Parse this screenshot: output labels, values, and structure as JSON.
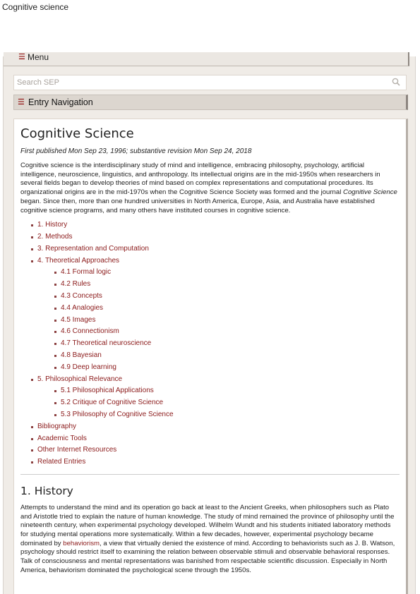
{
  "window": {
    "title": "Cognitive science"
  },
  "menu": {
    "label": "Menu"
  },
  "search": {
    "placeholder": "Search SEP"
  },
  "entry_nav": {
    "label": "Entry Navigation"
  },
  "entry": {
    "title": "Cognitive Science",
    "pubinfo": "First published Mon Sep 23, 1996; substantive revision Mon Sep 24, 2018",
    "intro_part1": "Cognitive science is the interdisciplinary study of mind and intelligence, embracing philosophy, psychology, artificial intelligence, neuroscience, linguistics, and anthropology. Its intellectual origins are in the mid-1950s when researchers in several fields began to develop theories of mind based on complex representations and computational procedures. Its organizational origins are in the mid-1970s when the Cognitive Science Society was formed and the journal ",
    "intro_em": "Cognitive Science",
    "intro_part2": " began. Since then, more than one hundred universities in North America, Europe, Asia, and Australia have established cognitive science programs, and many others have instituted courses in cognitive science."
  },
  "toc": {
    "history": "1. History",
    "methods": "2. Methods",
    "representation": "3. Representation and Computation",
    "theoretical": "4. Theoretical Approaches",
    "theoretical_sub": {
      "formal_logic": "4.1 Formal logic",
      "rules": "4.2 Rules",
      "concepts": "4.3 Concepts",
      "analogies": "4.4 Analogies",
      "images": "4.5 Images",
      "connectionism": "4.6 Connectionism",
      "neuroscience": "4.7 Theoretical neuroscience",
      "bayesian": "4.8 Bayesian",
      "deep_learning": "4.9 Deep learning"
    },
    "philosophical": "5. Philosophical Relevance",
    "philosophical_sub": {
      "applications": "5.1 Philosophical Applications",
      "critique": "5.2 Critique of Cognitive Science",
      "philosophy": "5.3 Philosophy of Cognitive Science"
    },
    "bibliography": "Bibliography",
    "academic_tools": "Academic Tools",
    "internet_resources": "Other Internet Resources",
    "related_entries": "Related Entries"
  },
  "section1": {
    "heading": "1. History",
    "text_part1": "Attempts to understand the mind and its operation go back at least to the Ancient Greeks, when philosophers such as Plato and Aristotle tried to explain the nature of human knowledge. The study of mind remained the province of philosophy until the nineteenth century, when experimental psychology developed. Wilhelm Wundt and his students initiated laboratory methods for studying mental operations more systematically. Within a few decades, however, experimental psychology became dominated by ",
    "link_behaviorism": "behaviorism",
    "text_part2": ", a view that virtually denied the existence of mind. According to behaviorists such as J. B. Watson, psychology should restrict itself to examining the relation between observable stimuli and observable behavioral responses. Talk of consciousness and mental representations was banished from respectable scientific discussion. Especially in North America, behaviorism dominated the psychological scene through the 1950s."
  },
  "colors": {
    "link": "#8b1a1a",
    "frame_bg": "#f0ece7",
    "nav_bg": "#dcd6cf",
    "icon_red": "#8b0000"
  },
  "icons": {
    "menu": "hamburger-icon",
    "search": "search-icon",
    "entry_nav": "hamburger-icon"
  }
}
